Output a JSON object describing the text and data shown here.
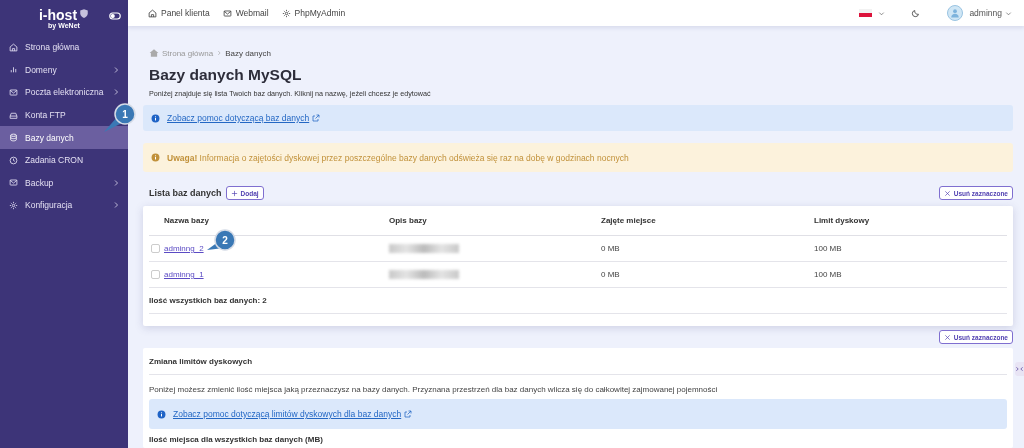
{
  "sidebar": {
    "logo": "i-host",
    "logo_sub": "by WeNet",
    "items": [
      {
        "label": "Strona główna",
        "has_submenu": false,
        "selected": false
      },
      {
        "label": "Domeny",
        "has_submenu": true,
        "selected": false
      },
      {
        "label": "Poczta elektroniczna",
        "has_submenu": true,
        "selected": false
      },
      {
        "label": "Konta FTP",
        "has_submenu": false,
        "selected": false
      },
      {
        "label": "Bazy danych",
        "has_submenu": false,
        "selected": true
      },
      {
        "label": "Zadania CRON",
        "has_submenu": false,
        "selected": false
      },
      {
        "label": "Backup",
        "has_submenu": true,
        "selected": false
      },
      {
        "label": "Konfiguracja",
        "has_submenu": true,
        "selected": false
      }
    ]
  },
  "topbar": {
    "links": [
      "Panel klienta",
      "Webmail",
      "PhpMyAdmin"
    ],
    "user": "adminng"
  },
  "breadcrumb": [
    "Strona główna",
    "Bazy danych"
  ],
  "title": "Bazy danych MySQL",
  "intro": "Poniżej znajduje się lista Twoich baz danych. Kliknij na nazwę, jeżeli chcesz je edytować",
  "help_link": "Zobacz pomoc dotyczącą baz danych",
  "warning": "**Uwaga!** Informacja o zajętości dyskowej przez poszczególne bazy danych odświeża się raz na dobę w godzinach nocnych",
  "list_title": "Lista baz danych",
  "add_button": "Dodaj",
  "delete_buttons": [
    "Usuń zaznaczone",
    "Usuń zaznaczone"
  ],
  "table": {
    "columns": [
      "Nazwa bazy",
      "Opis bazy",
      "Zajęte miejsce",
      "Limit dyskowy"
    ],
    "rows": [
      {
        "checked": false,
        "name": "adminng_2",
        "used": "0 MB",
        "limit": "100 MB"
      },
      {
        "checked": false,
        "name": "adminng_1",
        "used": "0 MB",
        "limit": "100 MB"
      }
    ],
    "total": "Ilość wszystkich baz danych: 2"
  },
  "callouts": [
    "1",
    "2"
  ],
  "limits": {
    "title": "Zmiana limitów dyskowych",
    "text": "Poniżej możesz zmienić ilość miejsca jaką przeznaczysz na bazy danych. Przyznana przestrzeń dla baz danych wlicza się do całkowitej zajmowanej pojemności",
    "help_link": "Zobacz pomoc dotyczącą limitów dyskowych dla baz danych",
    "field_label": "Ilość miejsca dla wszystkich baz danych (MB)"
  }
}
